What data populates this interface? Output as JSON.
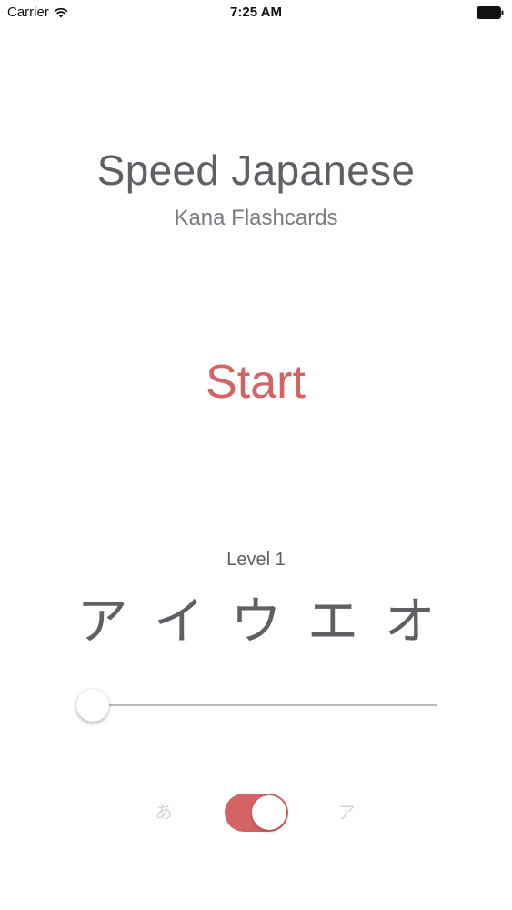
{
  "status_bar": {
    "carrier": "Carrier",
    "time": "7:25 AM",
    "icons": [
      "wifi-icon",
      "battery-icon"
    ]
  },
  "header": {
    "title": "Speed Japanese",
    "subtitle": "Kana Flashcards"
  },
  "start_label": "Start",
  "level": {
    "label": "Level 1",
    "kana": [
      "ア",
      "イ",
      "ウ",
      "エ",
      "オ"
    ]
  },
  "level_slider": {
    "value_fraction": 0.0
  },
  "kana_toggle": {
    "left_label": "あ",
    "right_label": "ア",
    "on": true
  },
  "colors": {
    "accent": "#d46464",
    "text": "#5f5f66",
    "muted_label": "#d4d4d8",
    "track": "#b9b9bf"
  }
}
